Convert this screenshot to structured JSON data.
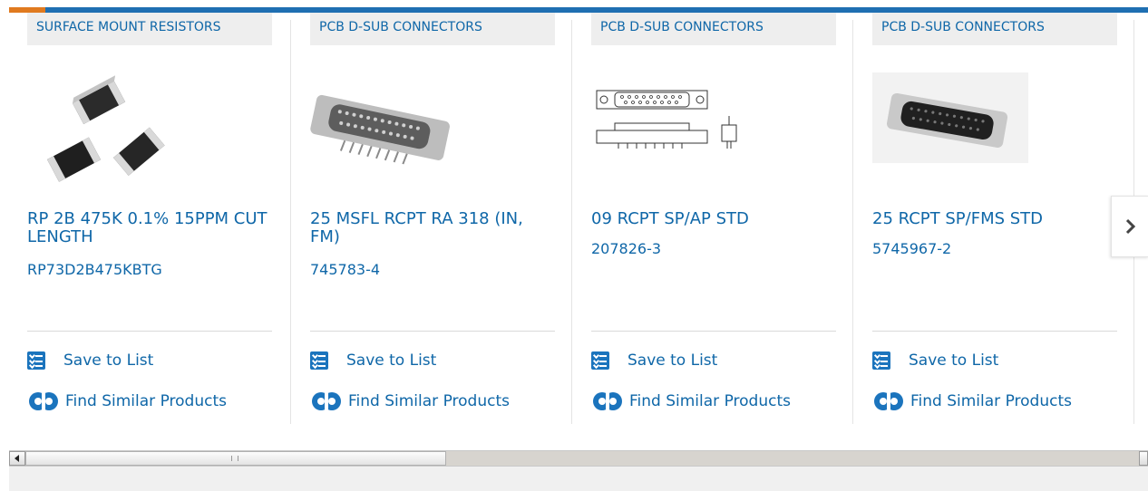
{
  "cards": [
    {
      "category": "SURFACE MOUNT RESISTORS",
      "title": "RP 2B 475K 0.1% 15PPM CUT LENGTH",
      "part_number": "RP73D2B475KBTG",
      "save_label": "Save to List",
      "find_label": "Find Similar Products"
    },
    {
      "category": "PCB D-SUB CONNECTORS",
      "title": "25 MSFL RCPT RA 318 (IN, FM)",
      "part_number": "745783-4",
      "save_label": "Save to List",
      "find_label": "Find Similar Products"
    },
    {
      "category": "PCB D-SUB CONNECTORS",
      "title": "09 RCPT SP/AP STD",
      "part_number": "207826-3",
      "save_label": "Save to List",
      "find_label": "Find Similar Products"
    },
    {
      "category": "PCB D-SUB CONNECTORS",
      "title": "25 RCPT SP/FMS STD",
      "part_number": "5745967-2",
      "save_label": "Save to List",
      "find_label": "Find Similar Products"
    }
  ],
  "icons": {
    "save": "checklist-icon",
    "find": "gears-icon",
    "next": "chevron-right-icon",
    "scroll_left": "scroll-left-arrow-icon",
    "scroll_right": "scroll-right-arrow-icon"
  },
  "colors": {
    "link": "#0f67a8",
    "top_bar": "#1f6fb2",
    "top_bar_accent": "#e07a1f",
    "category_bg": "#eeeeee",
    "icon_blue": "#1b74bd"
  }
}
